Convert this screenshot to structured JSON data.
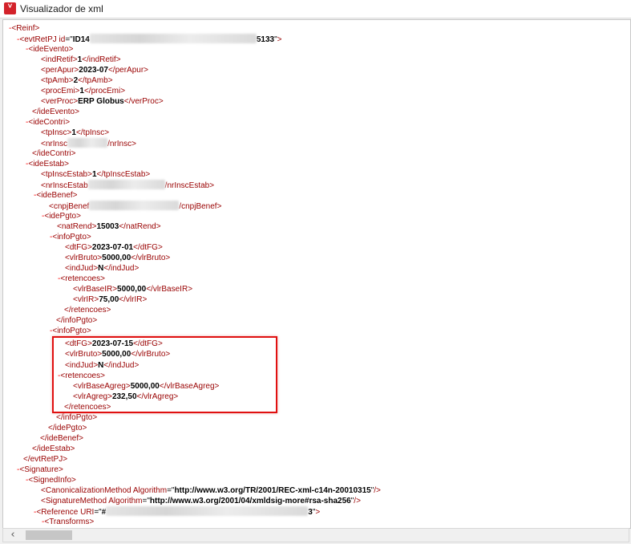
{
  "window": {
    "title": "Visualizador de xml",
    "icon_glyph": "ⱽ"
  },
  "xml": {
    "reinf": "Reinf",
    "evtRetPJ": "evtRetPJ",
    "evt_attr": "id",
    "evt_id_prefix": "ID14",
    "evt_id_suffix": "5133",
    "ideEvento": "ideEvento",
    "indRetif": {
      "tag": "indRetif",
      "value": "1"
    },
    "perApur": {
      "tag": "perApur",
      "value": "2023-07"
    },
    "tpAmb": {
      "tag": "tpAmb",
      "value": "2"
    },
    "procEmi": {
      "tag": "procEmi",
      "value": "1"
    },
    "verProc": {
      "tag": "verProc",
      "value": "ERP Globus"
    },
    "ideContri": "ideContri",
    "tpInsc": {
      "tag": "tpInsc",
      "value": "1"
    },
    "nrInsc": {
      "tag": "nrInsc"
    },
    "ideEstab": "ideEstab",
    "tpInscEstab": {
      "tag": "tpInscEstab",
      "value": "1"
    },
    "nrInscEstab": {
      "tag": "nrInscEstab"
    },
    "ideBenef": "ideBenef",
    "cnpjBenef": {
      "tag": "cnpjBenef"
    },
    "idePgto": "idePgto",
    "natRend": {
      "tag": "natRend",
      "value": "15003"
    },
    "infoPgto": "infoPgto",
    "retencoes": "retencoes",
    "pgto1": {
      "dtFG": {
        "tag": "dtFG",
        "value": "2023-07-01"
      },
      "vlrBruto": {
        "tag": "vlrBruto",
        "value": "5000,00"
      },
      "indJud": {
        "tag": "indJud",
        "value": "N"
      },
      "vlrBaseIR": {
        "tag": "vlrBaseIR",
        "value": "5000,00"
      },
      "vlrIR": {
        "tag": "vlrIR",
        "value": "75,00"
      }
    },
    "pgto2": {
      "dtFG": {
        "tag": "dtFG",
        "value": "2023-07-15"
      },
      "vlrBruto": {
        "tag": "vlrBruto",
        "value": "5000,00"
      },
      "indJud": {
        "tag": "indJud",
        "value": "N"
      },
      "vlrBaseAgreg": {
        "tag": "vlrBaseAgreg",
        "value": "5000,00"
      },
      "vlrAgreg": {
        "tag": "vlrAgreg",
        "value": "232,50"
      }
    },
    "Signature": "Signature",
    "SignedInfo": "SignedInfo",
    "canon": {
      "tag": "CanonicalizationMethod",
      "attr": "Algorithm",
      "value": "http://www.w3.org/TR/2001/REC-xml-c14n-20010315"
    },
    "sigmethod": {
      "tag": "SignatureMethod",
      "attr": "Algorithm",
      "value": "http://www.w3.org/2001/04/xmldsig-more#rsa-sha256"
    },
    "reference": {
      "tag": "Reference",
      "attr": "URI",
      "value_prefix": "#",
      "value_suffix": "3"
    },
    "Transforms": "Transforms"
  },
  "toggle_glyph": "-",
  "colors": {
    "tag": "#990000",
    "toggle": "#ff0000",
    "highlight": "#e01010"
  }
}
